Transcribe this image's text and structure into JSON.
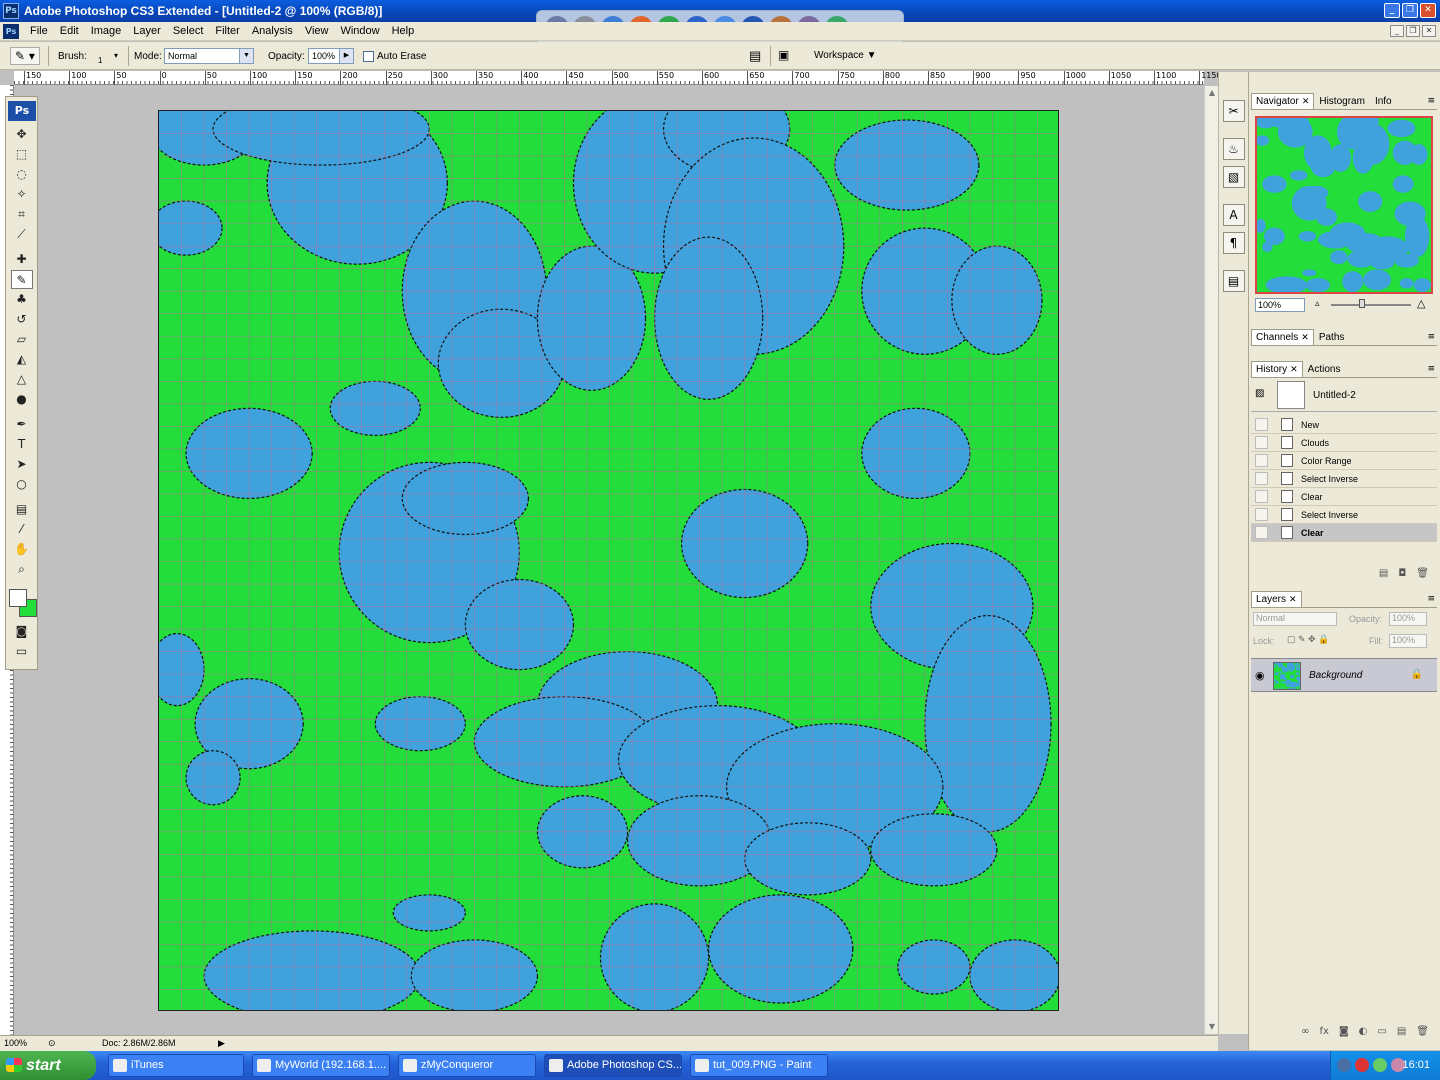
{
  "window": {
    "title": "Adobe Photoshop CS3 Extended - [Untitled-2 @ 100% (RGB/8)]",
    "app_icon": "Ps"
  },
  "menu": [
    "File",
    "Edit",
    "Image",
    "Layer",
    "Select",
    "Filter",
    "Analysis",
    "View",
    "Window",
    "Help"
  ],
  "options": {
    "brush_label": "Brush:",
    "brush_size": "1",
    "mode_label": "Mode:",
    "mode_value": "Normal",
    "opacity_label": "Opacity:",
    "opacity_value": "100%",
    "auto_erase_label": "Auto Erase",
    "workspace_label": "Workspace"
  },
  "dock_items": [
    {
      "label": "E",
      "color": "#6b7aa8"
    },
    {
      "label": "E",
      "color": "#8a8f9c"
    },
    {
      "label": "⚙",
      "color": "#3c7fd9"
    },
    {
      "label": "●",
      "color": "#e0662a"
    },
    {
      "label": "◐",
      "color": "#2fa84d"
    },
    {
      "label": "◉",
      "color": "#2d62c9"
    },
    {
      "label": "♫",
      "color": "#4b8be3"
    },
    {
      "label": "Ps",
      "color": "#2558b5"
    },
    {
      "label": "CIV",
      "color": "#b8733a"
    },
    {
      "label": "◈",
      "color": "#7a6aa0"
    },
    {
      "label": "◆",
      "color": "#3aa86a"
    }
  ],
  "ruler_labels": [
    "150",
    "100",
    "50",
    "0",
    "50",
    "100",
    "150",
    "200",
    "250",
    "300",
    "350",
    "400",
    "450",
    "500",
    "550",
    "600",
    "650",
    "700",
    "750",
    "800",
    "850",
    "900",
    "950",
    "1000",
    "1050",
    "1100",
    "1150"
  ],
  "tools": [
    {
      "icon": "move-icon",
      "glyph": "✥"
    },
    {
      "icon": "marquee-icon",
      "glyph": "⬚"
    },
    {
      "icon": "lasso-icon",
      "glyph": "◌"
    },
    {
      "icon": "magic-wand-icon",
      "glyph": "✧"
    },
    {
      "icon": "crop-icon",
      "glyph": "⌗"
    },
    {
      "icon": "slice-icon",
      "glyph": "⟋"
    },
    {
      "icon": "healing-brush-icon",
      "glyph": "✚"
    },
    {
      "icon": "pencil-icon",
      "glyph": "✎"
    },
    {
      "icon": "clone-stamp-icon",
      "glyph": "♣"
    },
    {
      "icon": "history-brush-icon",
      "glyph": "↺"
    },
    {
      "icon": "eraser-icon",
      "glyph": "▱"
    },
    {
      "icon": "paint-bucket-icon",
      "glyph": "◭"
    },
    {
      "icon": "blur-icon",
      "glyph": "△"
    },
    {
      "icon": "dodge-icon",
      "glyph": "●"
    },
    {
      "icon": "pen-icon",
      "glyph": "✒"
    },
    {
      "icon": "type-icon",
      "glyph": "T"
    },
    {
      "icon": "path-selection-icon",
      "glyph": "➤"
    },
    {
      "icon": "ellipse-icon",
      "glyph": "○"
    },
    {
      "icon": "notes-icon",
      "glyph": "▤"
    },
    {
      "icon": "eyedropper-icon",
      "glyph": "⁄"
    },
    {
      "icon": "hand-icon",
      "glyph": "✋"
    },
    {
      "icon": "zoom-icon",
      "glyph": "⌕"
    }
  ],
  "colors": {
    "foreground": "#ffffff",
    "background": "#22dd3a",
    "land": "#22dd3a",
    "water": "#3fa2dd"
  },
  "status": {
    "zoom": "100%",
    "doc_size": "Doc: 2.86M/2.86M"
  },
  "navigator": {
    "tabs": [
      "Navigator",
      "Histogram",
      "Info"
    ],
    "zoom": "100%"
  },
  "channels": {
    "tabs": [
      "Channels",
      "Paths"
    ]
  },
  "history": {
    "tabs": [
      "History",
      "Actions"
    ],
    "snapshot": "Untitled-2",
    "steps": [
      "New",
      "Clouds",
      "Color Range",
      "Select Inverse",
      "Clear",
      "Select Inverse",
      "Clear"
    ],
    "selected_index": 6
  },
  "layers": {
    "tabs": [
      "Layers"
    ],
    "blend_mode": "Normal",
    "opacity_label": "Opacity:",
    "opacity": "100%",
    "lock_label": "Lock:",
    "fill_label": "Fill:",
    "fill": "100%",
    "items": [
      {
        "name": "Background",
        "locked": true
      }
    ]
  },
  "taskbar": {
    "start": "start",
    "tasks": [
      "iTunes",
      "MyWorld (192.168.1....",
      "zMyConqueror",
      "Adobe Photoshop CS...",
      "tut_009.PNG - Paint"
    ],
    "active_index": 3,
    "clock": "16:01"
  }
}
